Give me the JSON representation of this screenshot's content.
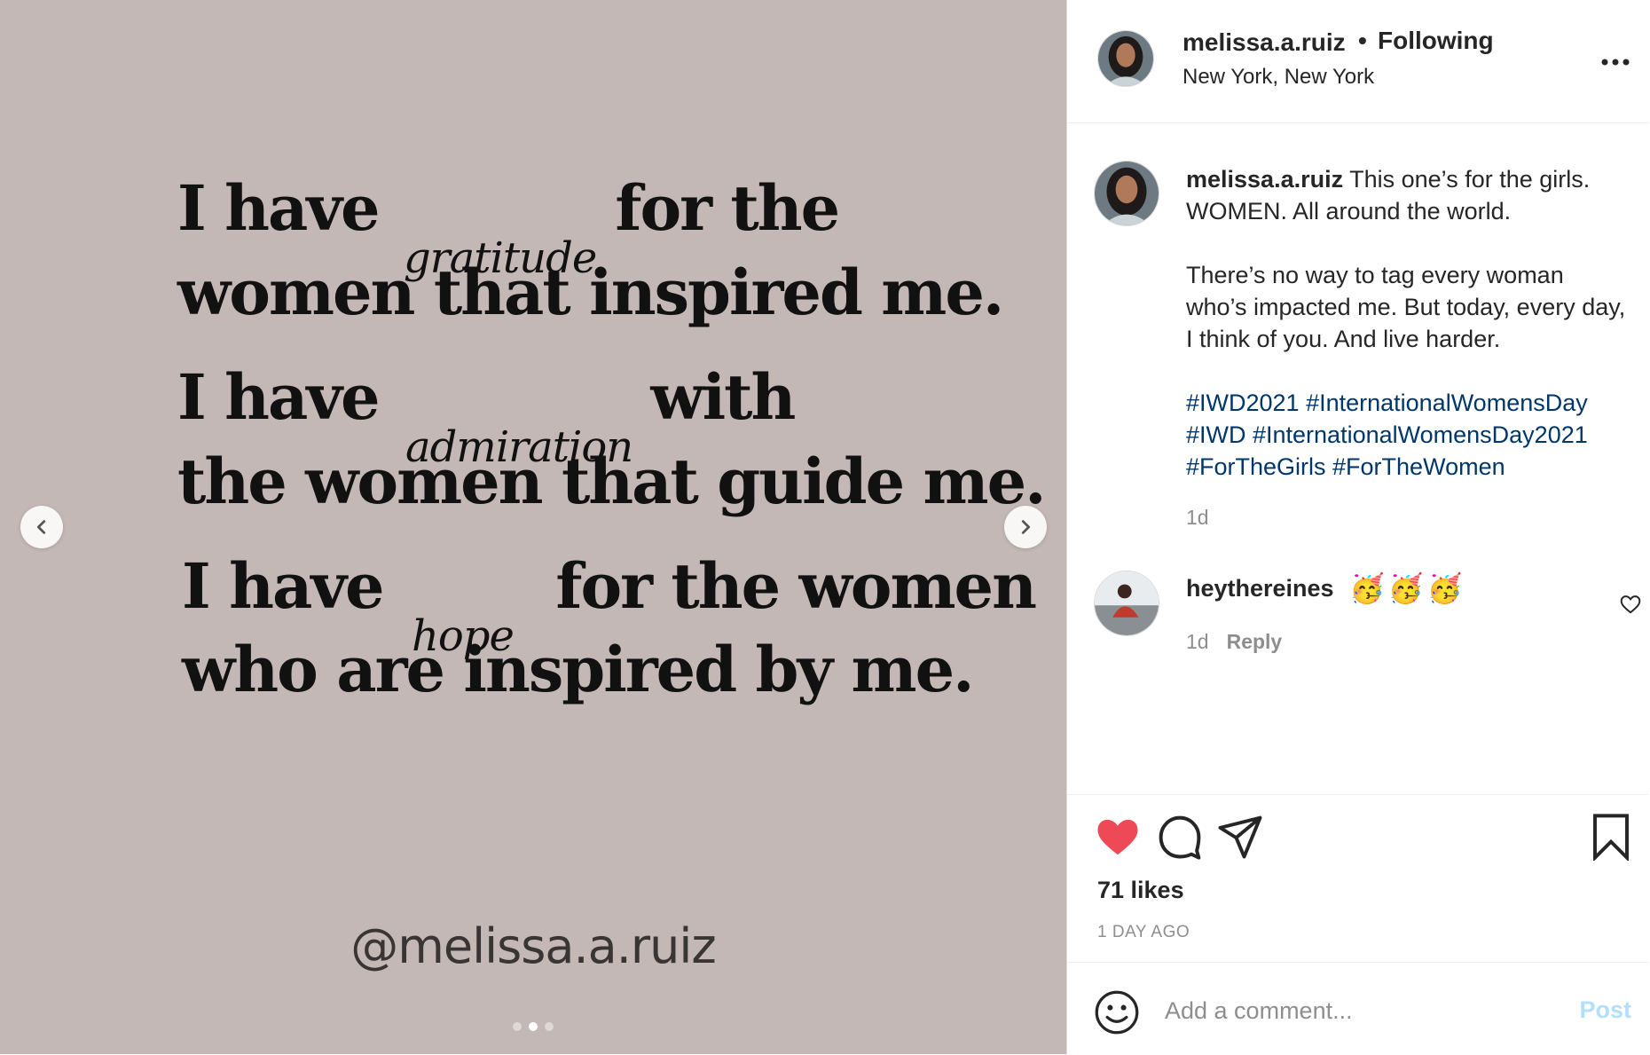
{
  "post": {
    "quote": {
      "line1_a": "I have",
      "line1_script": "gratitude",
      "line1_b": "for the",
      "line2": "women that inspired me.",
      "line3_a": "I have",
      "line3_script": "admiration",
      "line3_b": "with",
      "line4": "the women that guide me.",
      "line5_a": "I have",
      "line5_script": "hope",
      "line5_b": "for the women",
      "line6": "who are inspired by me."
    },
    "watermark": "@melissa.a.ruiz",
    "carousel": {
      "slides": 3,
      "active": 2
    }
  },
  "header": {
    "username": "melissa.a.ruiz",
    "separator": "•",
    "follow_status": "Following",
    "location": "New York, New York"
  },
  "caption": {
    "username": "melissa.a.ruiz",
    "text1": "This one’s for the girls. WOMEN. All around the world.",
    "text2": "There’s no way to tag every woman who’s impacted me. But today, every day, I think of you. And live harder.",
    "hashtags": "#IWD2021 #InternationalWomensDay #IWD #InternationalWomensDay2021 #ForTheGirls #ForTheWomen",
    "time": "1d"
  },
  "comment": {
    "username": "heythereines",
    "emoji": "🥳🥳🥳",
    "time": "1d",
    "reply": "Reply"
  },
  "actions": {
    "likes": "71 likes",
    "posted": "1 DAY AGO"
  },
  "add_comment": {
    "placeholder": "Add a comment...",
    "post_label": "Post"
  },
  "colors": {
    "media_bg": "#c3b8b6",
    "like": "#ed4956",
    "hashtag": "#00376b",
    "post_disabled": "#b2dffc"
  }
}
